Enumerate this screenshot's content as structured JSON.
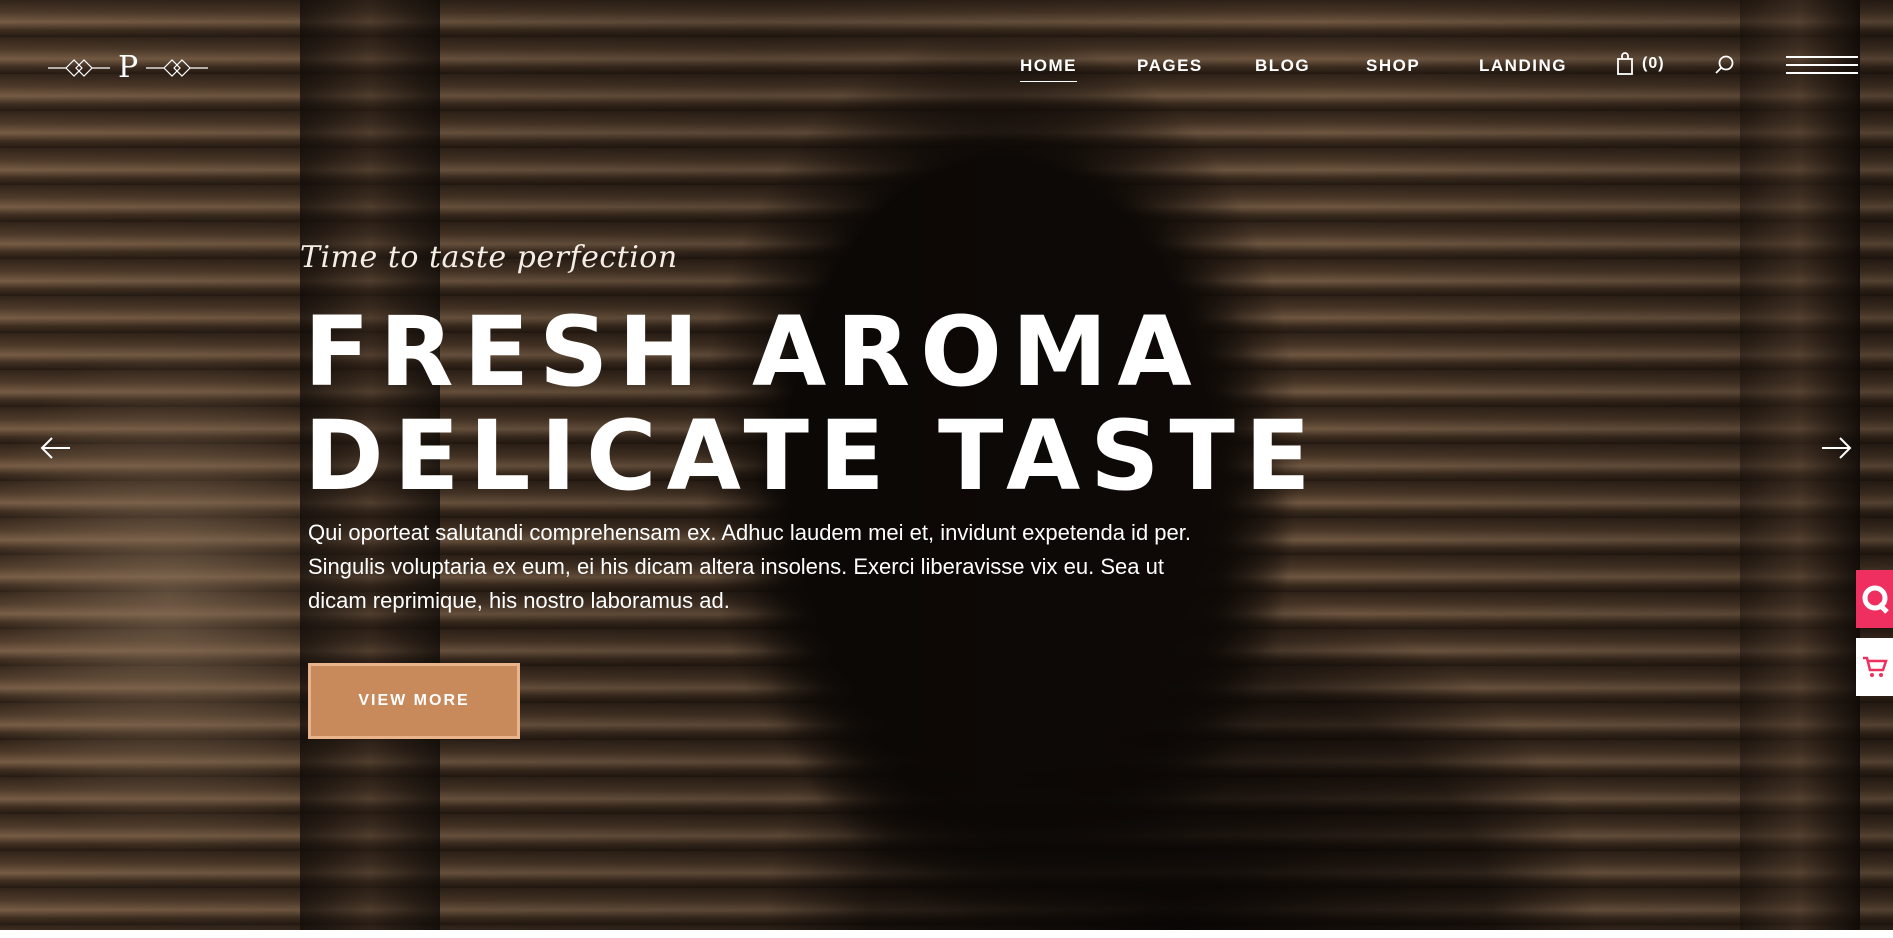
{
  "header": {
    "logo_letter": "P",
    "nav": [
      {
        "label": "HOME",
        "active": true
      },
      {
        "label": "PAGES",
        "active": false
      },
      {
        "label": "BLOG",
        "active": false
      },
      {
        "label": "SHOP",
        "active": false
      },
      {
        "label": "LANDING",
        "active": false
      }
    ],
    "cart_count": "(0)",
    "icons": [
      "shopping-bag-icon",
      "search-icon",
      "hamburger-menu-icon"
    ]
  },
  "slide": {
    "tagline": "Time to taste perfection",
    "headline_line1": "FRESH AROMA",
    "headline_line2": "DELICATE TASTE",
    "description": "Qui oporteat salutandi comprehensam ex. Adhuc laudem mei et, invidunt expetenda id per. Singulis voluptaria ex eum, ei his dicam altera insolens. Exerci liberavisse vix eu. Sea ut dicam reprimique, his nostro laboramus ad.",
    "cta_label": "VIEW MORE"
  },
  "side_widgets": [
    {
      "icon": "chat-icon",
      "color": "#ef2f5f"
    },
    {
      "icon": "cart-icon",
      "color": "#ef2f5f"
    }
  ],
  "colors": {
    "accent": "#c98a5b",
    "accent_border": "#e9b48c",
    "side_pink": "#ef2f5f"
  }
}
